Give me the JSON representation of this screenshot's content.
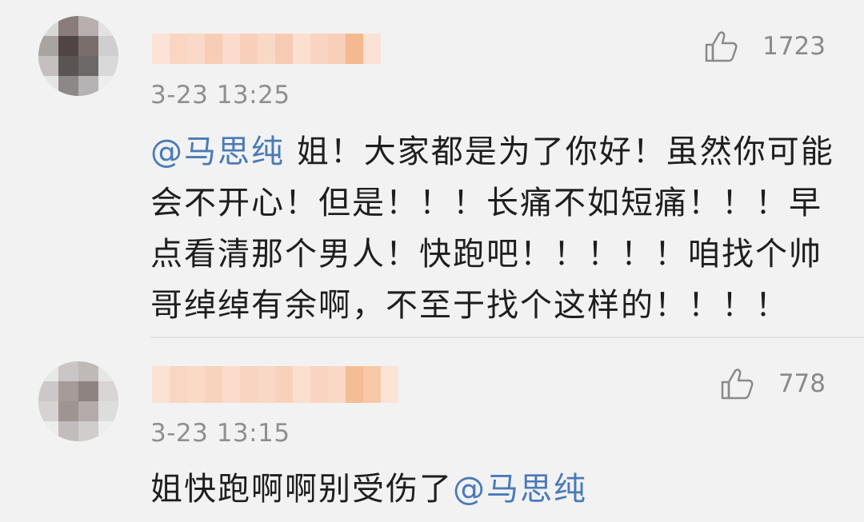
{
  "comments": [
    {
      "time": "3-23 13:25",
      "likes": "1723",
      "mention": "@马思纯",
      "text_after_mention": " 姐！大家都是为了你好！虽然你可能会不开心！但是！！！长痛不如短痛！！！早点看清那个男人！快跑吧！！！！！咱找个帅哥绰绰有余啊，不至于找个这样的！！！！"
    },
    {
      "time": "3-23 13:15",
      "likes": "778",
      "text_before_mention": "姐快跑啊啊别受伤了",
      "mention": "@马思纯"
    }
  ],
  "icons": {
    "like": "thumbs-up-icon"
  },
  "colors": {
    "mention": "#4a7ab8",
    "meta": "#8f8f8f",
    "background": "#f2f2f2"
  }
}
